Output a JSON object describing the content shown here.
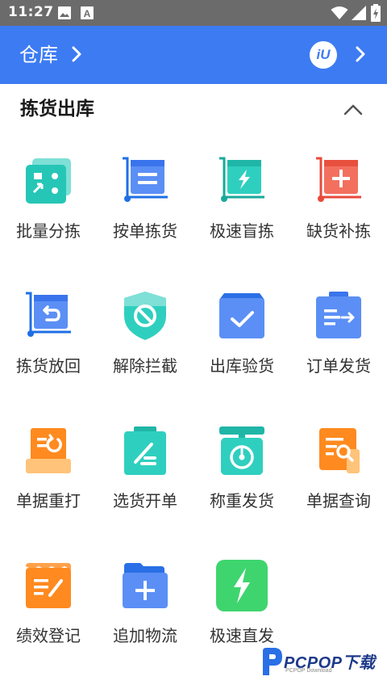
{
  "status_bar": {
    "time": "11:27",
    "icons": [
      "image-icon",
      "keyboard-a-icon",
      "wifi-icon",
      "signal-icon",
      "battery-charging-icon"
    ],
    "a_glyph": "A"
  },
  "header": {
    "title": "仓库",
    "logo_text": "iU",
    "accent_color": "#3d7bf3"
  },
  "section": {
    "title": "拣货出库"
  },
  "tiles": [
    {
      "label": "批量分拣",
      "icon": "batch-sort-icon"
    },
    {
      "label": "按单拣货",
      "icon": "order-pick-icon"
    },
    {
      "label": "极速盲拣",
      "icon": "fast-blind-pick-icon"
    },
    {
      "label": "缺货补拣",
      "icon": "restock-pick-icon"
    },
    {
      "label": "拣货放回",
      "icon": "pick-return-icon"
    },
    {
      "label": "解除拦截",
      "icon": "unblock-icon"
    },
    {
      "label": "出库验货",
      "icon": "outbound-check-icon"
    },
    {
      "label": "订单发货",
      "icon": "order-ship-icon"
    },
    {
      "label": "单据重打",
      "icon": "reprint-icon"
    },
    {
      "label": "选货开单",
      "icon": "select-invoice-icon"
    },
    {
      "label": "称重发货",
      "icon": "weigh-ship-icon"
    },
    {
      "label": "单据查询",
      "icon": "doc-search-icon"
    },
    {
      "label": "绩效登记",
      "icon": "performance-log-icon"
    },
    {
      "label": "追加物流",
      "icon": "add-logistics-icon"
    },
    {
      "label": "极速直发",
      "icon": "fast-direct-ship-icon"
    }
  ],
  "watermark": {
    "text": "PCPOP下载",
    "sub": "PCPOP Download"
  }
}
